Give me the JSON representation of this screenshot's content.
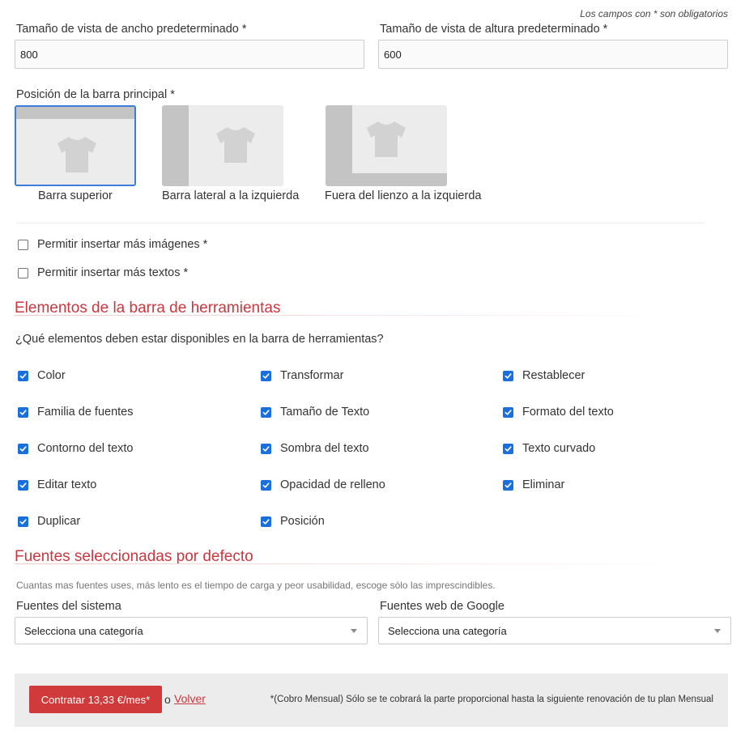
{
  "required_note": "Los campos con * son obligatorios",
  "view_size": {
    "width_label": "Tamaño de vista de ancho predeterminado *",
    "width_value": "800",
    "height_label": "Tamaño de vista de altura predeterminado *",
    "height_value": "600"
  },
  "main_bar": {
    "label": "Posición de la barra principal *",
    "options": [
      {
        "label": "Barra superior",
        "selected": true
      },
      {
        "label": "Barra lateral a la izquierda",
        "selected": false
      },
      {
        "label": "Fuera del lienzo a la izquierda",
        "selected": false
      }
    ]
  },
  "insert_options": {
    "more_images": {
      "label": "Permitir insertar más imágenes *",
      "checked": false
    },
    "more_texts": {
      "label": "Permitir insertar más textos *",
      "checked": false
    }
  },
  "toolbar": {
    "title": "Elementos de la barra de herramientas",
    "question": "¿Qué elementos deben estar disponibles en la barra de herramientas?",
    "items": [
      {
        "label": "Color",
        "checked": true
      },
      {
        "label": "Transformar",
        "checked": true
      },
      {
        "label": "Restablecer",
        "checked": true
      },
      {
        "label": "Familia de fuentes",
        "checked": true
      },
      {
        "label": "Tamaño de Texto",
        "checked": true
      },
      {
        "label": "Formato del texto",
        "checked": true
      },
      {
        "label": "Contorno del texto",
        "checked": true
      },
      {
        "label": "Sombra del texto",
        "checked": true
      },
      {
        "label": "Texto curvado",
        "checked": true
      },
      {
        "label": "Editar texto",
        "checked": true
      },
      {
        "label": "Opacidad de relleno",
        "checked": true
      },
      {
        "label": "Eliminar",
        "checked": true
      },
      {
        "label": "Duplicar",
        "checked": true
      },
      {
        "label": "Posición",
        "checked": true
      }
    ]
  },
  "fonts": {
    "title": "Fuentes seleccionadas por defecto",
    "help": "Cuantas mas fuentes uses, más lento es el tiempo de carga y peor usabilidad, escoge sólo las imprescindibles.",
    "system_label": "Fuentes del sistema",
    "system_value": "Selecciona una categoría",
    "google_label": "Fuentes web de Google",
    "google_value": "Selecciona una categoría"
  },
  "footer": {
    "buy_label": "Contratar 13,33 €/mes*",
    "or_text": "o",
    "back_label": "Volver",
    "note": "*(Cobro Mensual) Sólo se te cobrará la parte proporcional hasta la siguiente renovación de tu plan Mensual"
  },
  "colors": {
    "accent_red": "#c9373f",
    "button_red": "#d13a3a",
    "checkbox_blue": "#1a6fdb",
    "selected_border": "#3b7dd8"
  }
}
